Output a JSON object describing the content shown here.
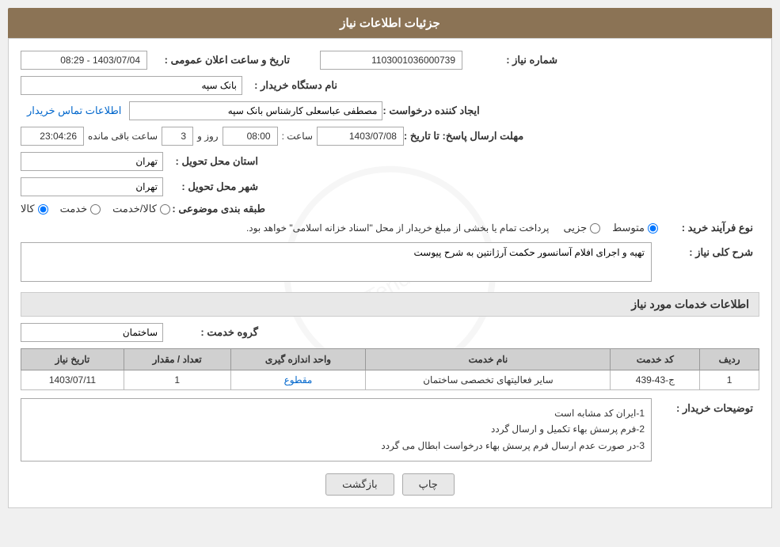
{
  "page": {
    "title": "جزئیات اطلاعات نیاز"
  },
  "header": {
    "label": "جزئیات اطلاعات نیاز"
  },
  "fields": {
    "need_number_label": "شماره نیاز :",
    "need_number_value": "1103001036000739",
    "announce_label": "تاریخ و ساعت اعلان عمومی :",
    "announce_value": "1403/07/04 - 08:29",
    "buyer_org_label": "نام دستگاه خریدار :",
    "buyer_org_value": "بانک سپه",
    "creator_label": "ایجاد کننده درخواست :",
    "creator_value": "مصطفی عباسعلی کارشناس بانک سپه",
    "contact_link": "اطلاعات تماس خریدار",
    "deadline_label": "مهلت ارسال پاسخ: تا تاریخ :",
    "deadline_date": "1403/07/08",
    "deadline_time_label": "ساعت :",
    "deadline_time": "08:00",
    "deadline_days_label": "روز و",
    "deadline_days": "3",
    "deadline_remaining_label": "ساعت باقی مانده",
    "deadline_remaining": "23:04:26",
    "province_label": "استان محل تحویل :",
    "province_value": "تهران",
    "city_label": "شهر محل تحویل :",
    "city_value": "تهران",
    "category_label": "طبقه بندی موضوعی :",
    "category_options": [
      "کالا",
      "خدمت",
      "کالا/خدمت"
    ],
    "category_selected": "کالا",
    "process_label": "نوع فرآیند خرید :",
    "process_options": [
      "جزیی",
      "متوسط"
    ],
    "process_selected": "متوسط",
    "process_note": "پرداخت تمام یا بخشی از مبلغ خریدار از محل \"اسناد خزانه اسلامی\" خواهد بود.",
    "need_desc_label": "شرح کلی نیاز :",
    "need_desc_value": "تهیه و اجرای افلام آسانسور حکمت آرژانتین به شرح پیوست",
    "services_section_title": "اطلاعات خدمات مورد نیاز",
    "service_group_label": "گروه خدمت :",
    "service_group_value": "ساختمان",
    "table": {
      "columns": [
        "ردیف",
        "کد خدمت",
        "نام خدمت",
        "واحد اندازه گیری",
        "تعداد / مقدار",
        "تاریخ نیاز"
      ],
      "rows": [
        {
          "row": "1",
          "code": "ج-43-439",
          "name": "سایر فعالیتهای تخصصی ساختمان",
          "unit": "مقطوع",
          "qty": "1",
          "date": "1403/07/11"
        }
      ]
    },
    "buyer_notes_label": "توضیحات خریدار :",
    "buyer_notes": [
      "1-ایران کد مشابه است",
      "2-فرم پرسش بهاء تکمیل و ارسال گردد",
      "3-در صورت عدم ارسال فرم پرسش بهاء درخواست ابطال می گردد"
    ]
  },
  "buttons": {
    "print": "چاپ",
    "back": "بازگشت"
  }
}
